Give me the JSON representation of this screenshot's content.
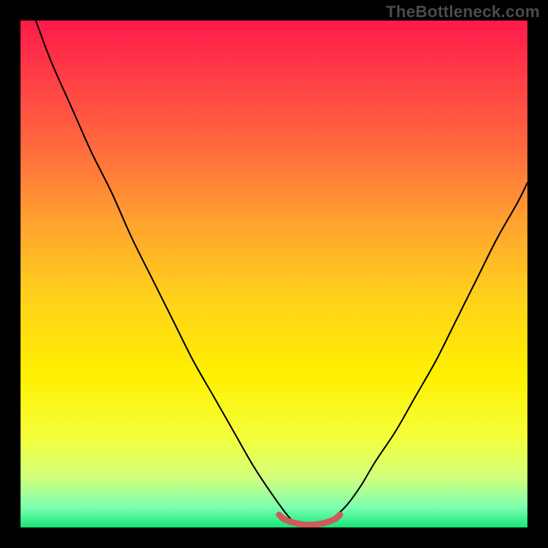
{
  "watermark": "TheBottleneck.com",
  "colors": {
    "frame": "#000000",
    "watermark_text": "#4a4a4a",
    "curve": "#000000",
    "trough_highlight": "#cf5a57",
    "gradient_stops": [
      {
        "offset": 0.0,
        "color": "#ff1a4b"
      },
      {
        "offset": 0.1,
        "color": "#ff3a46"
      },
      {
        "offset": 0.25,
        "color": "#ff6a3e"
      },
      {
        "offset": 0.4,
        "color": "#ffa32f"
      },
      {
        "offset": 0.55,
        "color": "#ffd21a"
      },
      {
        "offset": 0.7,
        "color": "#fff000"
      },
      {
        "offset": 0.82,
        "color": "#f4ff3a"
      },
      {
        "offset": 0.9,
        "color": "#d4ff7a"
      },
      {
        "offset": 0.96,
        "color": "#7dffb0"
      },
      {
        "offset": 1.0,
        "color": "#16e67a"
      }
    ]
  },
  "chart_data": {
    "type": "line",
    "title": "",
    "xlabel": "",
    "ylabel": "",
    "xlim": [
      0,
      100
    ],
    "ylim": [
      0,
      100
    ],
    "x": [
      0,
      3,
      6,
      10,
      14,
      18,
      22,
      26,
      30,
      34,
      38,
      42,
      46,
      50,
      53,
      55,
      58,
      61,
      64,
      67,
      70,
      74,
      78,
      82,
      86,
      90,
      94,
      98,
      100
    ],
    "values": [
      108,
      100,
      92,
      83,
      74,
      66,
      57,
      49,
      41,
      33,
      26,
      19,
      12,
      6,
      2,
      0.5,
      0.5,
      1.5,
      4,
      8,
      13,
      19,
      26,
      33,
      41,
      49,
      57,
      64,
      68
    ],
    "annotations": [
      {
        "name": "trough-highlight",
        "x_range": [
          51,
          63
        ],
        "y": 0.5
      }
    ]
  }
}
